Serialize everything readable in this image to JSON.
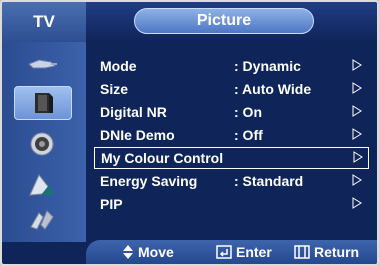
{
  "header": {
    "section_label": "TV",
    "title": "Picture"
  },
  "sidebar": {
    "icons": [
      {
        "name": "input-icon"
      },
      {
        "name": "picture-icon"
      },
      {
        "name": "sound-icon"
      },
      {
        "name": "channel-icon"
      },
      {
        "name": "setup-icon"
      }
    ]
  },
  "menu": {
    "items": [
      {
        "label": "Mode",
        "value": ": Dynamic"
      },
      {
        "label": "Size",
        "value": ": Auto Wide"
      },
      {
        "label": "Digital NR",
        "value": ": On"
      },
      {
        "label": "DNIe Demo",
        "value": ": Off"
      },
      {
        "label": "My Colour Control",
        "value": ""
      },
      {
        "label": "Energy Saving",
        "value": ": Standard"
      },
      {
        "label": "PIP",
        "value": ""
      }
    ],
    "selected_index": 4
  },
  "footer": {
    "move_label": "Move",
    "enter_label": "Enter",
    "return_label": "Return"
  }
}
